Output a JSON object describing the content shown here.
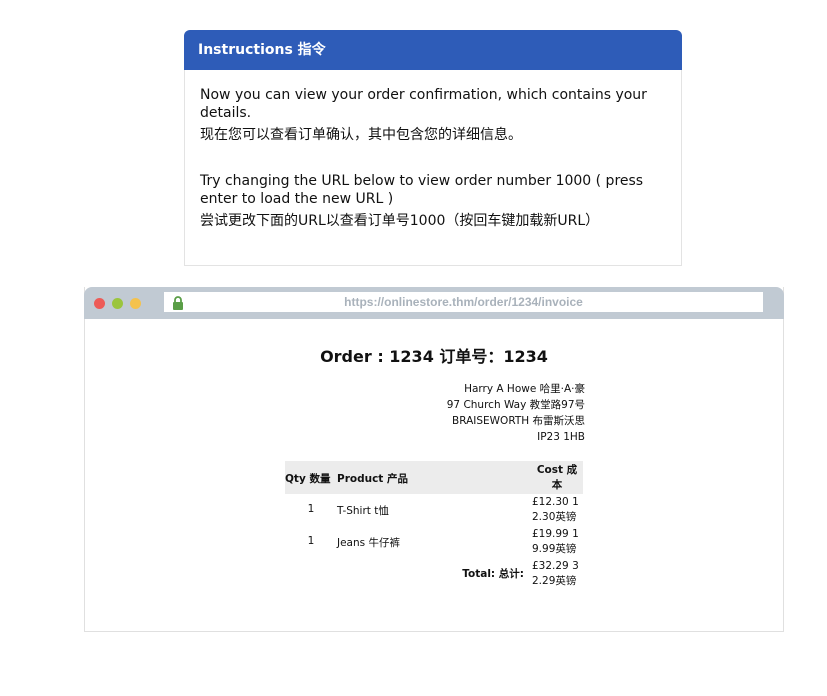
{
  "instructions": {
    "title": "Instructions  指令",
    "para1_en": "Now you can view your order confirmation, which contains your details.",
    "para1_zh": "现在您可以查看订单确认，其中包含您的详细信息。",
    "para2_en": "Try changing the URL below to view order number 1000 ( press enter to load the new URL )",
    "para2_zh": "尝试更改下面的URL以查看订单号1000（按回车键加载新URL）"
  },
  "browser": {
    "url": "https://onlinestore.thm/order/1234/invoice"
  },
  "invoice": {
    "title": "Order : 1234  订单号：1234",
    "address": {
      "name": "Harry A Howe  哈里·A·豪",
      "street": "97 Church Way  教堂路97号",
      "city": "BRAISEWORTH  布雷斯沃思",
      "postcode": "IP23 1HB"
    },
    "headers": {
      "qty": "Qty  数量",
      "product": "Product  产品",
      "cost": "Cost  成本"
    },
    "rows": [
      {
        "qty": "1",
        "product": "T-Shirt  t恤",
        "cost": "£12.30  12.30英镑"
      },
      {
        "qty": "1",
        "product": "Jeans  牛仔裤",
        "cost": "£19.99  19.99英镑"
      }
    ],
    "total_label": "Total:  总计:",
    "total_value": "£32.29  32.29英镑"
  }
}
